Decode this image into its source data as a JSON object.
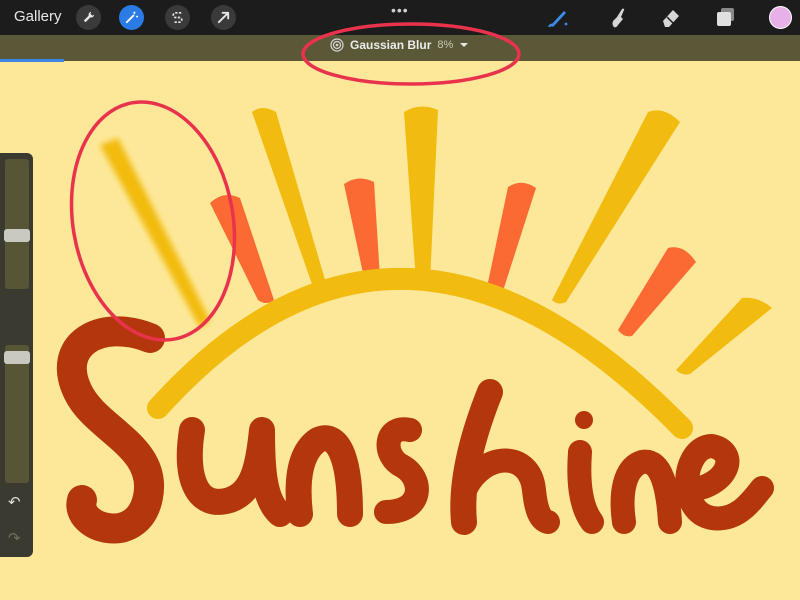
{
  "topbar": {
    "gallery_label": "Gallery",
    "more_label": "•••",
    "left_tools": [
      "wrench-icon",
      "magic-wand-icon",
      "selection-icon",
      "transform-arrow-icon"
    ],
    "right_tools": [
      "brush-icon",
      "smudge-icon",
      "eraser-icon",
      "layers-icon"
    ],
    "active_tool": "magic-wand-icon",
    "color": "#e8b0e8"
  },
  "adjustment": {
    "name": "Gaussian Blur",
    "percent": "8%",
    "progress_fraction": 0.08
  },
  "canvas": {
    "lettering": "Sunshine",
    "colors": {
      "background": "#fde89a",
      "rays_yellow": "#f2bb0f",
      "rays_orange": "#fb6a33",
      "lettering": "#b3360c",
      "annotation": "#e9334d"
    }
  },
  "sidebar": {
    "brush_size_level": 0.4,
    "opacity_level": 0.95
  }
}
